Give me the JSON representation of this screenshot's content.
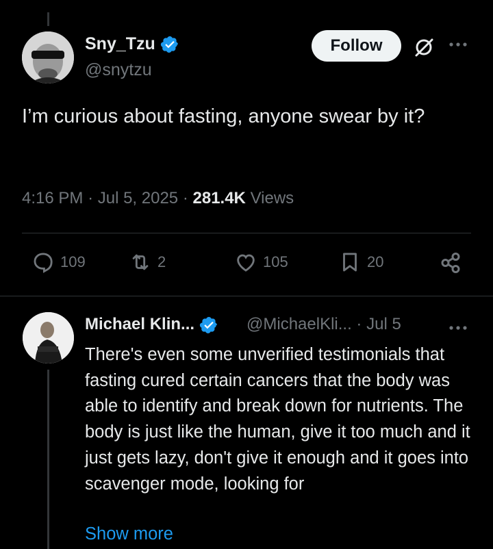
{
  "tweet": {
    "author_name": "Sny_Tzu",
    "author_handle": "@snytzu",
    "follow_label": "Follow",
    "text": "I’m curious about fasting, anyone swear by it?",
    "time": "4:16 PM",
    "date": "Jul 5, 2025",
    "views_count": "281.4K",
    "views_label": "Views",
    "replies": "109",
    "reposts": "2",
    "likes": "105",
    "bookmarks": "20"
  },
  "reply": {
    "author_name": "Michael Klin...",
    "author_handle": "@MichaelKli...",
    "date": "Jul 5",
    "text": "There's even some unverified testimonials that fasting cured certain cancers that the body was able to identify and break down for nutrients. The body is just like the human, give it too much and it just gets lazy, don't give it enough and it goes into scavenger mode, looking for",
    "show_more": "Show more"
  },
  "colors": {
    "background": "#000000",
    "text": "#e7e9ea",
    "secondary": "#71767b",
    "accent": "#1d9bf0",
    "divider": "#2f3336"
  },
  "icons": [
    "verified-badge-icon",
    "grok-icon",
    "more-icon",
    "reply-icon",
    "repost-icon",
    "like-icon",
    "bookmark-icon",
    "share-icon"
  ]
}
